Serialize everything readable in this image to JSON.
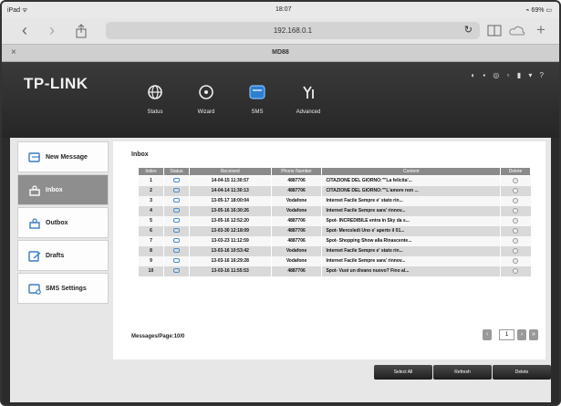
{
  "ios_status": {
    "left": "iPad ᯤ",
    "time": "18:07",
    "right": "⌁ 69% ▭"
  },
  "browser": {
    "url": "192.168.0.1",
    "tab_title": "MD88",
    "reload_icon": "reload-icon"
  },
  "router": {
    "logo": "TP-LINK",
    "top_icons": "◐ ▪ ◎ ▫ ▮ ▾ ?",
    "nav": [
      {
        "label": "Status",
        "icon": "globe-icon"
      },
      {
        "label": "Wizard",
        "icon": "gear-wizard-icon"
      },
      {
        "label": "SMS",
        "icon": "sms-icon"
      },
      {
        "label": "Advanced",
        "icon": "advanced-icon"
      }
    ]
  },
  "sidebar": {
    "items": [
      {
        "label": "New Message",
        "icon": "new-message-icon"
      },
      {
        "label": "Inbox",
        "icon": "inbox-icon"
      },
      {
        "label": "Outbox",
        "icon": "outbox-icon"
      },
      {
        "label": "Drafts",
        "icon": "drafts-icon"
      },
      {
        "label": "SMS Settings",
        "icon": "sms-settings-icon"
      }
    ]
  },
  "inbox": {
    "title": "Inbox",
    "columns": [
      "Index",
      "Status",
      "Received",
      "Phone Number",
      "Content",
      "Delete"
    ],
    "rows": [
      {
        "index": "1",
        "received": "14-04-15 11:30:57",
        "phone": "4887706",
        "content": "CITAZIONE DEL GIORNO:\"\"La felicita'..."
      },
      {
        "index": "2",
        "received": "14-04-14 11:30:13",
        "phone": "4887706",
        "content": "CITAZIONE DEL GIORNO:\"\"L'amore non ..."
      },
      {
        "index": "3",
        "received": "13-05-17 18:00:04",
        "phone": "Vodafone",
        "content": "Internet Facile Sempre e' stato rin..."
      },
      {
        "index": "4",
        "received": "13-05-16 16:30:26",
        "phone": "Vodafone",
        "content": "Internet Facile Sempre sara' rinnov..."
      },
      {
        "index": "5",
        "received": "13-05-16 12:52:20",
        "phone": "4887706",
        "content": "Spot- INCREDIBILE entra in Sky da s..."
      },
      {
        "index": "6",
        "received": "13-03-30 12:18:09",
        "phone": "4887706",
        "content": "Spot- Mercoledì Uno e' aperto il 01..."
      },
      {
        "index": "7",
        "received": "13-03-23 11:12:59",
        "phone": "4887706",
        "content": "Spot- Shopping Show alla Rinascente..."
      },
      {
        "index": "8",
        "received": "13-03-16 10:53:42",
        "phone": "Vodafone",
        "content": "Internet Facile Sempre e' stato rin..."
      },
      {
        "index": "9",
        "received": "13-03-16 16:29:28",
        "phone": "Vodafone",
        "content": "Internet Facile Sempre sara' rinnov..."
      },
      {
        "index": "10",
        "received": "13-03-16 11:55:53",
        "phone": "4887706",
        "content": "Spot- Vuoi un divano nuovo? Fino al..."
      }
    ],
    "messages_per_page": "Messages/Page:10/0",
    "page": "1",
    "prev": "‹",
    "next": "›",
    "last": "»"
  },
  "actions": {
    "select_all": "Select All",
    "refresh": "Refresh",
    "delete": "Delete"
  }
}
